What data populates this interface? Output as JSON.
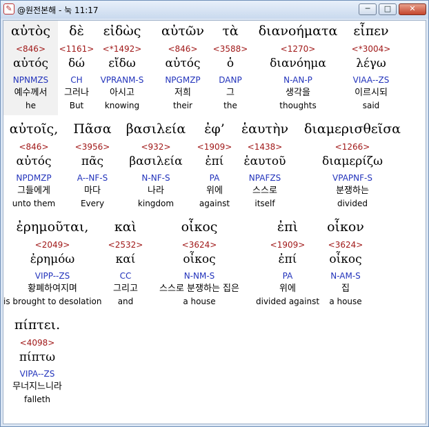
{
  "window": {
    "title": "@원전본해 - 눅 11:17",
    "app_icon": "app-icon",
    "buttons": {
      "minimize": "─",
      "maximize": "□",
      "close": "✕"
    }
  },
  "rows": [
    {
      "words": [
        {
          "greek": "αὐτὸς",
          "strong": "<846>",
          "lemma": "αὐτός",
          "parse": "NPNMZS",
          "korean": "예수께서",
          "english": "he"
        },
        {
          "greek": "δὲ",
          "strong": "<1161>",
          "lemma": "δώ",
          "parse": "CH",
          "korean": "그러나",
          "english": "But"
        },
        {
          "greek": "εἰδὼς",
          "strong": "<*1492>",
          "lemma": "εἴδω",
          "parse": "VPRANM-S",
          "korean": "아시고",
          "english": "knowing"
        },
        {
          "greek": "αὐτῶν",
          "strong": "<846>",
          "lemma": "αὐτός",
          "parse": "NPGMZP",
          "korean": "저희",
          "english": "their"
        },
        {
          "greek": "τὰ",
          "strong": "<3588>",
          "lemma": "ὁ",
          "parse": "DANP",
          "korean": "그",
          "english": "the"
        },
        {
          "greek": "διανοήματα",
          "strong": "<1270>",
          "lemma": "διανόημα",
          "parse": "N-AN-P",
          "korean": "생각을",
          "english": "thoughts"
        },
        {
          "greek": "εἶπεν",
          "strong": "<*3004>",
          "lemma": "λέγω",
          "parse": "VIAA--ZS",
          "korean": "이르시되",
          "english": "said"
        }
      ]
    },
    {
      "words": [
        {
          "greek": "αὐτοῖς,",
          "strong": "<846>",
          "lemma": "αὐτός",
          "parse": "NPDMZP",
          "korean": "그들에게",
          "english": "unto them"
        },
        {
          "greek": "Πᾶσα",
          "strong": "<3956>",
          "lemma": "πᾶς",
          "parse": "A--NF-S",
          "korean": "마다",
          "english": "Every"
        },
        {
          "greek": "βασιλεία",
          "strong": "<932>",
          "lemma": "βασιλεία",
          "parse": "N-NF-S",
          "korean": "나라",
          "english": "kingdom"
        },
        {
          "greek": "ἐφ’",
          "strong": "<1909>",
          "lemma": "ἐπί",
          "parse": "PA",
          "korean": "위에",
          "english": "against"
        },
        {
          "greek": "ἑαυτὴν",
          "strong": "<1438>",
          "lemma": "ἑαυτοῦ",
          "parse": "NPAFZS",
          "korean": "스스로",
          "english": "itself"
        },
        {
          "greek": "διαμερισθεῖσα",
          "strong": "<1266>",
          "lemma": "διαμερίζω",
          "parse": "VPAPNF-S",
          "korean": "분쟁하는",
          "english": "divided"
        }
      ]
    },
    {
      "words": [
        {
          "greek": "ἐρημοῦται,",
          "strong": "<2049>",
          "lemma": "ἐρημόω",
          "parse": "VIPP--ZS",
          "korean": "황폐하여지며",
          "english": "is brought to desolation"
        },
        {
          "greek": "καὶ",
          "strong": "<2532>",
          "lemma": "καί",
          "parse": "CC",
          "korean": "그리고",
          "english": "and"
        },
        {
          "greek": "οἶκος",
          "strong": "<3624>",
          "lemma": "οἶκος",
          "parse": "N-NM-S",
          "korean": "스스로 분쟁하는 집은",
          "english": "a house"
        },
        {
          "greek": "ἐπὶ",
          "strong": "<1909>",
          "lemma": "ἐπί",
          "parse": "PA",
          "korean": "위에",
          "english": "divided against"
        },
        {
          "greek": "οἶκον",
          "strong": "<3624>",
          "lemma": "οἶκος",
          "parse": "N-AM-S",
          "korean": "집",
          "english": "a house"
        }
      ]
    },
    {
      "words": [
        {
          "greek": "πίπτει.",
          "strong": "<4098>",
          "lemma": "πίπτω",
          "parse": "VIPA--ZS",
          "korean": "무너지느니라",
          "english": "falleth"
        }
      ]
    }
  ]
}
